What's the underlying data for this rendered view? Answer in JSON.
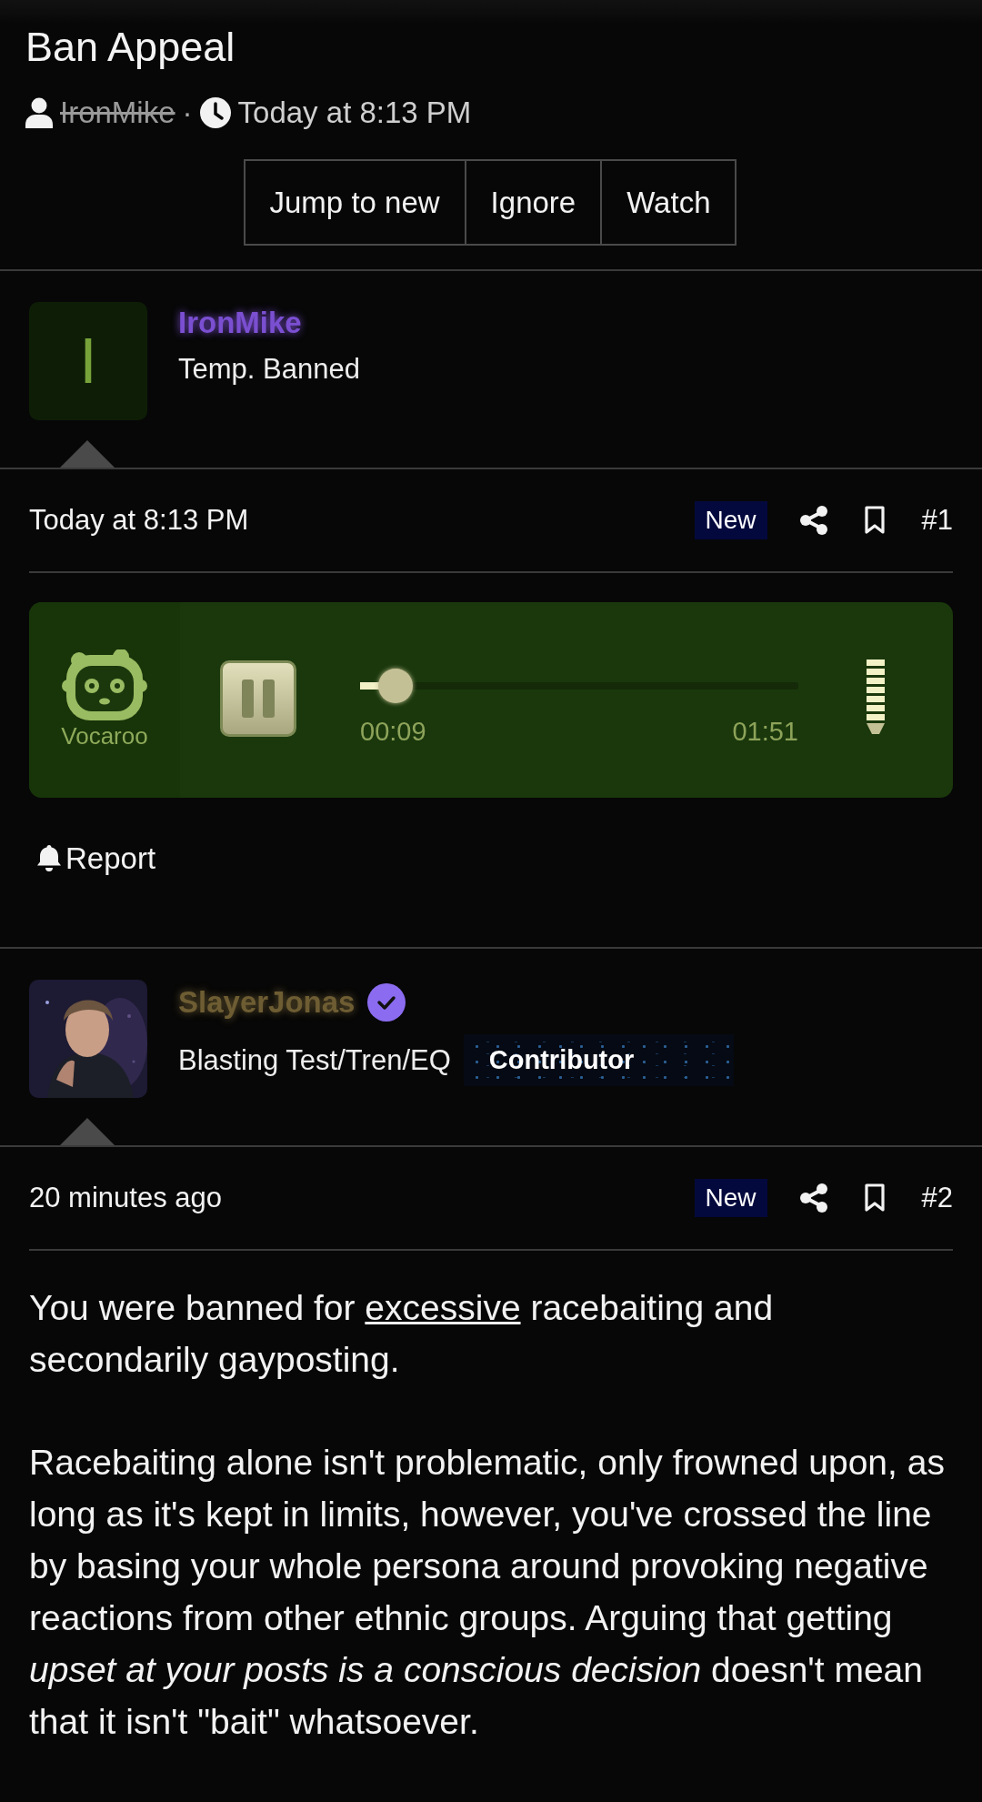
{
  "thread": {
    "title": "Ban Appeal",
    "author": "IronMike",
    "author_struck": true,
    "separator": "·",
    "date": "Today at 8:13 PM"
  },
  "thread_actions": [
    "Jump to new",
    "Ignore",
    "Watch"
  ],
  "posts": [
    {
      "avatar": {
        "kind": "letter",
        "letter": "I"
      },
      "username": "IronMike",
      "color": "#7b4fd1",
      "verified": false,
      "user_title": "Temp. Banned",
      "date": "Today at 8:13 PM",
      "new_label": "New",
      "number": "#1",
      "content": {
        "kind": "audio",
        "brand": "Vocaroo",
        "playing": true,
        "level": 0.08,
        "elapsed": "00:09",
        "duration": "01:51"
      },
      "report": "Report"
    },
    {
      "username": "SlayerJonas",
      "color": "#6e5d33",
      "verified": true,
      "user_title": "Blasting Test/Tren/EQ",
      "user_badge": "Contributor",
      "date": "20 minutes ago",
      "new_label": "New",
      "number": "#2",
      "content": {
        "kind": "text",
        "paragraphs": [
          [
            {
              "kind": "plain",
              "text": "You were banned for "
            },
            {
              "kind": "underline",
              "text": "excessive"
            },
            {
              "kind": "plain",
              "text": " racebaiting and secondarily gayposting."
            }
          ],
          [
            {
              "kind": "plain",
              "text": "Racebaiting alone isn't problematic, only frowned upon, as long as it's kept in limits, however, you've crossed the line by basing your whole persona around provoking negative reactions from other ethnic groups. Arguing that getting "
            },
            {
              "kind": "italic",
              "text": "upset at your posts is a conscious decision"
            },
            {
              "kind": "plain",
              "text": " doesn't mean that it isn't \"bait\" whatsoever."
            }
          ]
        ]
      }
    }
  ]
}
